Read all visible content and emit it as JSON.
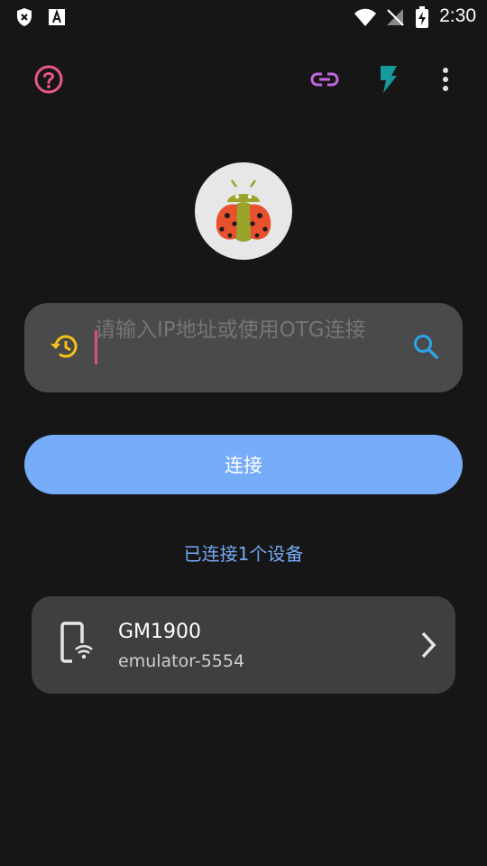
{
  "status_bar": {
    "time": "2:30"
  },
  "colors": {
    "background": "#161616",
    "help_icon": "#e8578a",
    "link_icon": "#c265e0",
    "flash_icon": "#159b9b",
    "history_icon": "#f3c318",
    "search_icon": "#2aa4ea",
    "connect_button": "#76acf9",
    "connected_text": "#74aaf6",
    "card": "#3f3f3f"
  },
  "toolbar": {
    "help_icon": "help-circle-icon",
    "link_icon": "link-icon",
    "flash_icon": "flash-icon",
    "more_icon": "more-vert-icon"
  },
  "input": {
    "placeholder": "请输入IP地址或使用OTG连接",
    "value": ""
  },
  "connect_button": {
    "label": "连接"
  },
  "connected_text": "已连接1个设备",
  "devices": [
    {
      "name": "GM1900",
      "serial": "emulator-5554"
    }
  ]
}
